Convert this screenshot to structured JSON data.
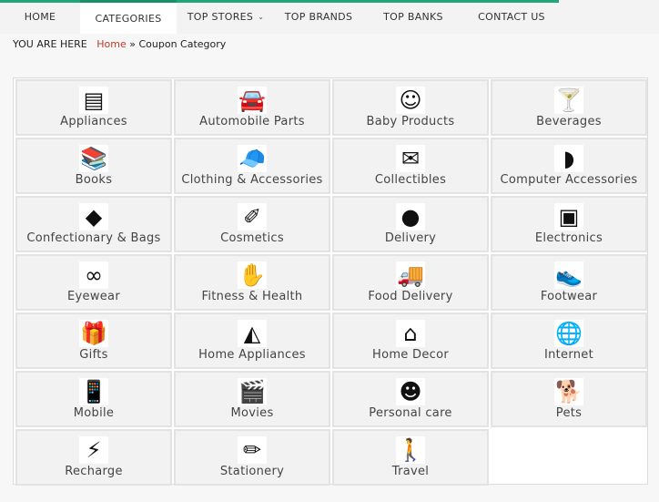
{
  "nav": {
    "items": [
      {
        "label": "HOME",
        "active": false,
        "has_dropdown": false
      },
      {
        "label": "CATEGORIES",
        "active": true,
        "has_dropdown": false
      },
      {
        "label": "TOP STORES",
        "active": false,
        "has_dropdown": true
      },
      {
        "label": "TOP BRANDS",
        "active": false,
        "has_dropdown": false
      },
      {
        "label": "TOP BANKS",
        "active": false,
        "has_dropdown": false
      },
      {
        "label": "CONTACT US",
        "active": false,
        "has_dropdown": false
      }
    ],
    "accent_color": "#21a67a"
  },
  "breadcrumb": {
    "prefix": "YOU ARE HERE",
    "home": "Home",
    "separator": "»",
    "current": "Coupon Category",
    "link_color": "#c0392b"
  },
  "categories": [
    {
      "label": "Appliances",
      "icon": "stove-icon",
      "glyph": "▤"
    },
    {
      "label": "Automobile Parts",
      "icon": "car-icon",
      "glyph": "🚘"
    },
    {
      "label": "Baby Products",
      "icon": "baby-icon",
      "glyph": "☺"
    },
    {
      "label": "Beverages",
      "icon": "cocktail-icon",
      "glyph": "🍸"
    },
    {
      "label": "Books",
      "icon": "books-icon",
      "glyph": "📚"
    },
    {
      "label": "Clothing & Accessories",
      "icon": "cap-icon",
      "glyph": "🧢"
    },
    {
      "label": "Collectibles",
      "icon": "envelope-icon",
      "glyph": "✉"
    },
    {
      "label": "Computer Accessories",
      "icon": "mouse-icon",
      "glyph": "◗"
    },
    {
      "label": "Confectionary & Bags",
      "icon": "candy-icon",
      "glyph": "◆"
    },
    {
      "label": "Cosmetics",
      "icon": "cosmetics-icon",
      "glyph": "✐"
    },
    {
      "label": "Delivery",
      "icon": "free-delivery-icon",
      "glyph": "●"
    },
    {
      "label": "Electronics",
      "icon": "phone-icon",
      "glyph": "▣"
    },
    {
      "label": "Eyewear",
      "icon": "glasses-icon",
      "glyph": "∞"
    },
    {
      "label": "Fitness & Health",
      "icon": "hand-heart-icon",
      "glyph": "✋"
    },
    {
      "label": "Food Delivery",
      "icon": "food-truck-icon",
      "glyph": "🚚"
    },
    {
      "label": "Footwear",
      "icon": "shoe-icon",
      "glyph": "👟"
    },
    {
      "label": "Gifts",
      "icon": "gift-icon",
      "glyph": "🎁"
    },
    {
      "label": "Home Appliances",
      "icon": "iron-icon",
      "glyph": "◭"
    },
    {
      "label": "Home Decor",
      "icon": "home-heart-icon",
      "glyph": "⌂"
    },
    {
      "label": "Internet",
      "icon": "globe-icon",
      "glyph": "🌐"
    },
    {
      "label": "Mobile",
      "icon": "mobile-icon",
      "glyph": "📱"
    },
    {
      "label": "Movies",
      "icon": "clapperboard-icon",
      "glyph": "🎬"
    },
    {
      "label": "Personal care",
      "icon": "head-icon",
      "glyph": "☻"
    },
    {
      "label": "Pets",
      "icon": "dog-icon",
      "glyph": "🐕"
    },
    {
      "label": "Recharge",
      "icon": "lightning-icon",
      "glyph": "⚡"
    },
    {
      "label": "Stationery",
      "icon": "stationery-icon",
      "glyph": "✏"
    },
    {
      "label": "Travel",
      "icon": "traveler-icon",
      "glyph": "🚶"
    }
  ]
}
